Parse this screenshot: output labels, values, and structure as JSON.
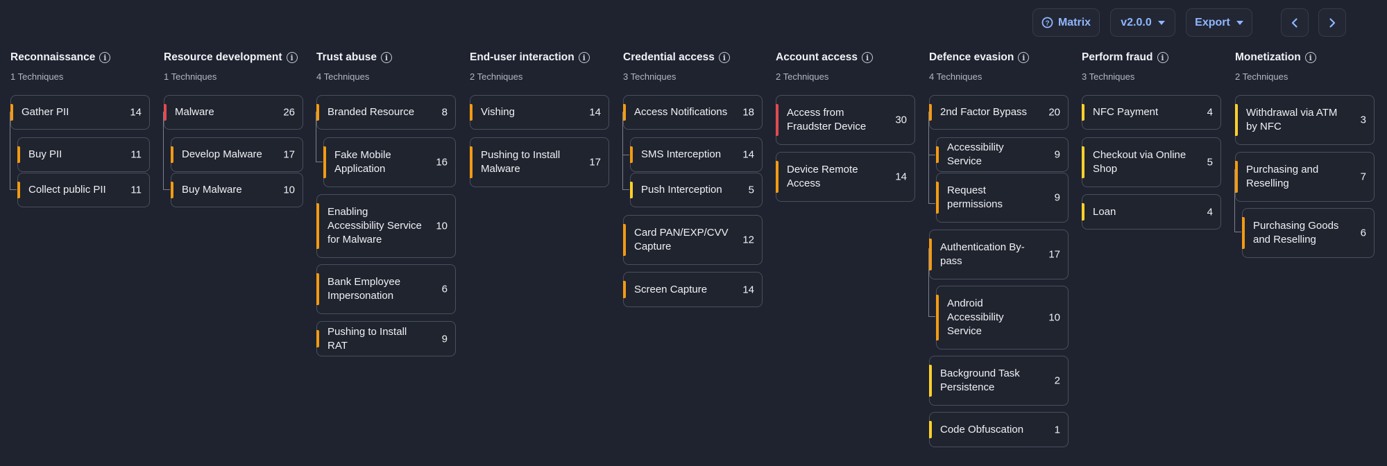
{
  "toolbar": {
    "matrix_label": "Matrix",
    "version_label": "v2.0.0",
    "export_label": "Export"
  },
  "colors": {
    "background": "#1f2330",
    "accent": "#8fb7ff",
    "severity_red": "#e24a4f",
    "severity_orange": "#f39a13",
    "severity_yellow": "#ffd02a"
  },
  "tactics": [
    {
      "title": "Reconnaissance",
      "subtitle": "1 Techniques",
      "techniques": [
        {
          "name": "Gather PII",
          "count": "14",
          "severity": "orange"
        },
        {
          "name": "Buy PII",
          "count": "11",
          "severity": "orange"
        },
        {
          "name": "Collect public PII",
          "count": "11",
          "severity": "orange"
        }
      ]
    },
    {
      "title": "Resource development",
      "subtitle": "1 Techniques",
      "techniques": [
        {
          "name": "Malware",
          "count": "26",
          "severity": "red"
        },
        {
          "name": "Develop Malware",
          "count": "17",
          "severity": "orange"
        },
        {
          "name": "Buy Malware",
          "count": "10",
          "severity": "orange"
        }
      ]
    },
    {
      "title": "Trust abuse",
      "subtitle": "4 Techniques",
      "techniques": [
        {
          "name": "Branded Resource",
          "count": "8",
          "severity": "orange"
        },
        {
          "name": "Fake Mobile Application",
          "count": "16",
          "severity": "orange"
        },
        {
          "name": "Enabling Accessibility Service for Malware",
          "count": "10",
          "severity": "orange"
        },
        {
          "name": "Bank Employee Impersonation",
          "count": "6",
          "severity": "orange"
        },
        {
          "name": "Pushing to Install RAT",
          "count": "9",
          "severity": "orange"
        }
      ]
    },
    {
      "title": "End-user interaction",
      "subtitle": "2 Techniques",
      "techniques": [
        {
          "name": "Vishing",
          "count": "14",
          "severity": "orange"
        },
        {
          "name": "Pushing to Install Malware",
          "count": "17",
          "severity": "orange"
        }
      ]
    },
    {
      "title": "Credential access",
      "subtitle": "3 Techniques",
      "techniques": [
        {
          "name": "Access Notifications",
          "count": "18",
          "severity": "orange"
        },
        {
          "name": "SMS Interception",
          "count": "14",
          "severity": "orange"
        },
        {
          "name": "Push Interception",
          "count": "5",
          "severity": "yellow"
        },
        {
          "name": "Card PAN/EXP/CVV Capture",
          "count": "12",
          "severity": "orange"
        },
        {
          "name": "Screen Capture",
          "count": "14",
          "severity": "orange"
        }
      ]
    },
    {
      "title": "Account access",
      "subtitle": "2 Techniques",
      "techniques": [
        {
          "name": "Access from Fraudster Device",
          "count": "30",
          "severity": "red"
        },
        {
          "name": "Device Remote Access",
          "count": "14",
          "severity": "orange"
        }
      ]
    },
    {
      "title": "Defence evasion",
      "subtitle": "4 Techniques",
      "techniques": [
        {
          "name": "2nd Factor Bypass",
          "count": "20",
          "severity": "orange"
        },
        {
          "name": "Accessibility Service",
          "count": "9",
          "severity": "orange"
        },
        {
          "name": "Request permissions",
          "count": "9",
          "severity": "orange"
        },
        {
          "name": "Authentication By-pass",
          "count": "17",
          "severity": "orange"
        },
        {
          "name": "Android Accessibility Service",
          "count": "10",
          "severity": "orange"
        },
        {
          "name": "Background Task Persistence",
          "count": "2",
          "severity": "yellow"
        },
        {
          "name": "Code Obfuscation",
          "count": "1",
          "severity": "yellow"
        }
      ]
    },
    {
      "title": "Perform fraud",
      "subtitle": "3 Techniques",
      "techniques": [
        {
          "name": "NFC Payment",
          "count": "4",
          "severity": "yellow"
        },
        {
          "name": "Checkout via Online Shop",
          "count": "5",
          "severity": "yellow"
        },
        {
          "name": "Loan",
          "count": "4",
          "severity": "yellow"
        }
      ]
    },
    {
      "title": "Monetization",
      "subtitle": "2 Techniques",
      "techniques": [
        {
          "name": "Withdrawal via ATM by NFC",
          "count": "3",
          "severity": "yellow"
        },
        {
          "name": "Purchasing and Reselling",
          "count": "7",
          "severity": "orange"
        },
        {
          "name": "Purchasing Goods and Reselling",
          "count": "6",
          "severity": "orange"
        }
      ]
    }
  ]
}
